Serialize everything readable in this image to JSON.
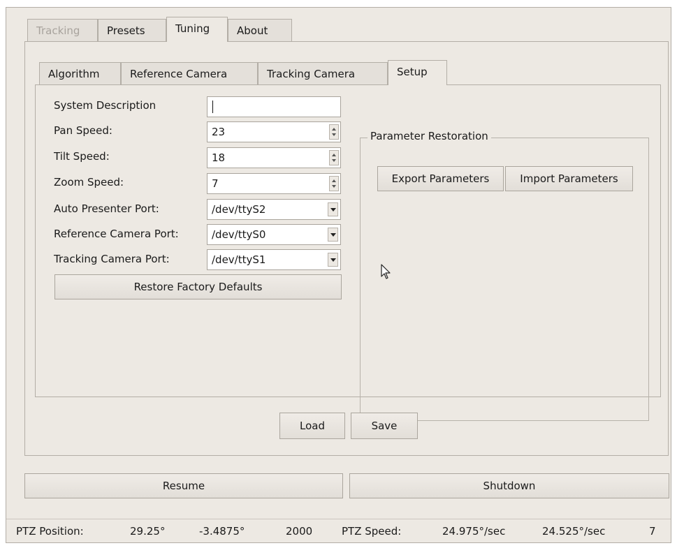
{
  "main_tabs": [
    {
      "label": "Tracking",
      "state": "disabled"
    },
    {
      "label": "Presets",
      "state": "normal"
    },
    {
      "label": "Tuning",
      "state": "active"
    },
    {
      "label": "About",
      "state": "normal"
    }
  ],
  "sub_tabs": [
    {
      "label": "Algorithm"
    },
    {
      "label": "Reference Camera"
    },
    {
      "label": "Tracking Camera"
    },
    {
      "label": "Setup",
      "state": "active"
    }
  ],
  "setup": {
    "system_description": {
      "label": "System Description",
      "value": ""
    },
    "pan_speed": {
      "label": "Pan Speed:",
      "value": "23"
    },
    "tilt_speed": {
      "label": "Tilt Speed:",
      "value": "18"
    },
    "zoom_speed": {
      "label": "Zoom Speed:",
      "value": "7"
    },
    "auto_presenter_port": {
      "label": "Auto Presenter Port:",
      "value": "/dev/ttyS2"
    },
    "reference_camera_port": {
      "label": "Reference Camera Port:",
      "value": "/dev/ttyS0"
    },
    "tracking_camera_port": {
      "label": "Tracking Camera Port:",
      "value": "/dev/ttyS1"
    },
    "restore_defaults_label": "Restore Factory Defaults"
  },
  "parameter_restoration": {
    "title": "Parameter Restoration",
    "export_label": "Export Parameters",
    "import_label": "Import Parameters"
  },
  "actions": {
    "load_label": "Load",
    "save_label": "Save"
  },
  "bottom": {
    "resume_label": "Resume",
    "shutdown_label": "Shutdown"
  },
  "status_bar": {
    "ptz_position_label": "PTZ Position:",
    "pan": "29.25°",
    "tilt": "-3.4875°",
    "zoom": "2000",
    "ptz_speed_label": "PTZ Speed:",
    "pan_speed": "24.975°/sec",
    "tilt_speed": "24.525°/sec",
    "zoom_speed": "7"
  },
  "icons": {
    "spinner": "spinbox-arrows-icon",
    "dropdown": "chevron-down-icon",
    "cursor": "mouse-pointer-icon"
  }
}
